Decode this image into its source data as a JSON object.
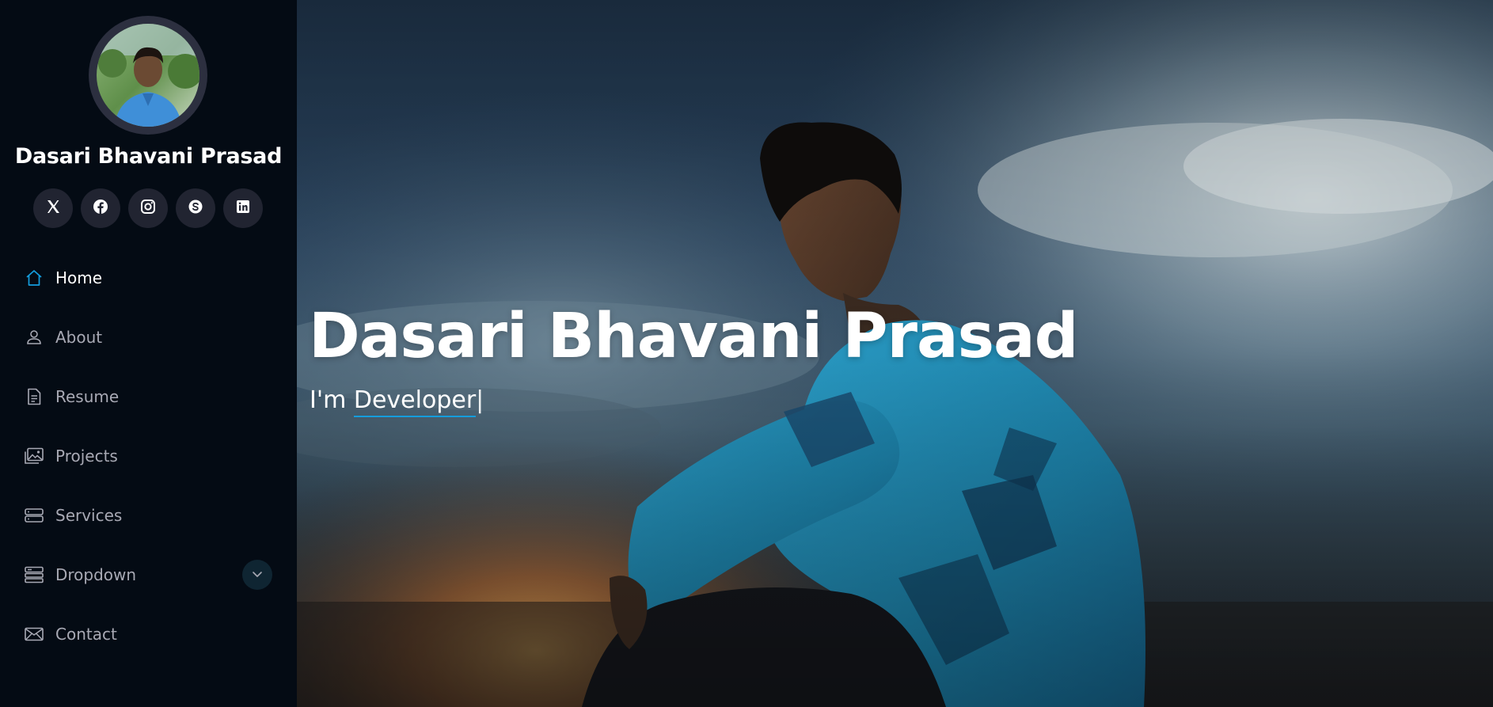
{
  "sidebar": {
    "profile_name": "Dasari Bhavani Prasad",
    "social": [
      {
        "icon": "x-twitter-icon"
      },
      {
        "icon": "facebook-icon"
      },
      {
        "icon": "instagram-icon"
      },
      {
        "icon": "skype-icon"
      },
      {
        "icon": "linkedin-icon"
      }
    ],
    "nav": [
      {
        "label": "Home",
        "icon": "home-icon",
        "active": true
      },
      {
        "label": "About",
        "icon": "person-icon",
        "active": false
      },
      {
        "label": "Resume",
        "icon": "file-text-icon",
        "active": false
      },
      {
        "label": "Projects",
        "icon": "images-icon",
        "active": false
      },
      {
        "label": "Services",
        "icon": "hdd-stack-icon",
        "active": false
      },
      {
        "label": "Dropdown",
        "icon": "menu-stack-icon",
        "active": false
      },
      {
        "label": "Contact",
        "icon": "envelope-icon",
        "active": false
      }
    ]
  },
  "hero": {
    "title": "Dasari Bhavani Prasad",
    "subtitle_prefix": "I'm ",
    "typed_text": "Developer",
    "cursor": "|"
  },
  "colors": {
    "accent": "#149ddd",
    "sidebar_bg": "#040b14",
    "nav_text": "#a8a9b4",
    "social_bg": "#212431"
  }
}
